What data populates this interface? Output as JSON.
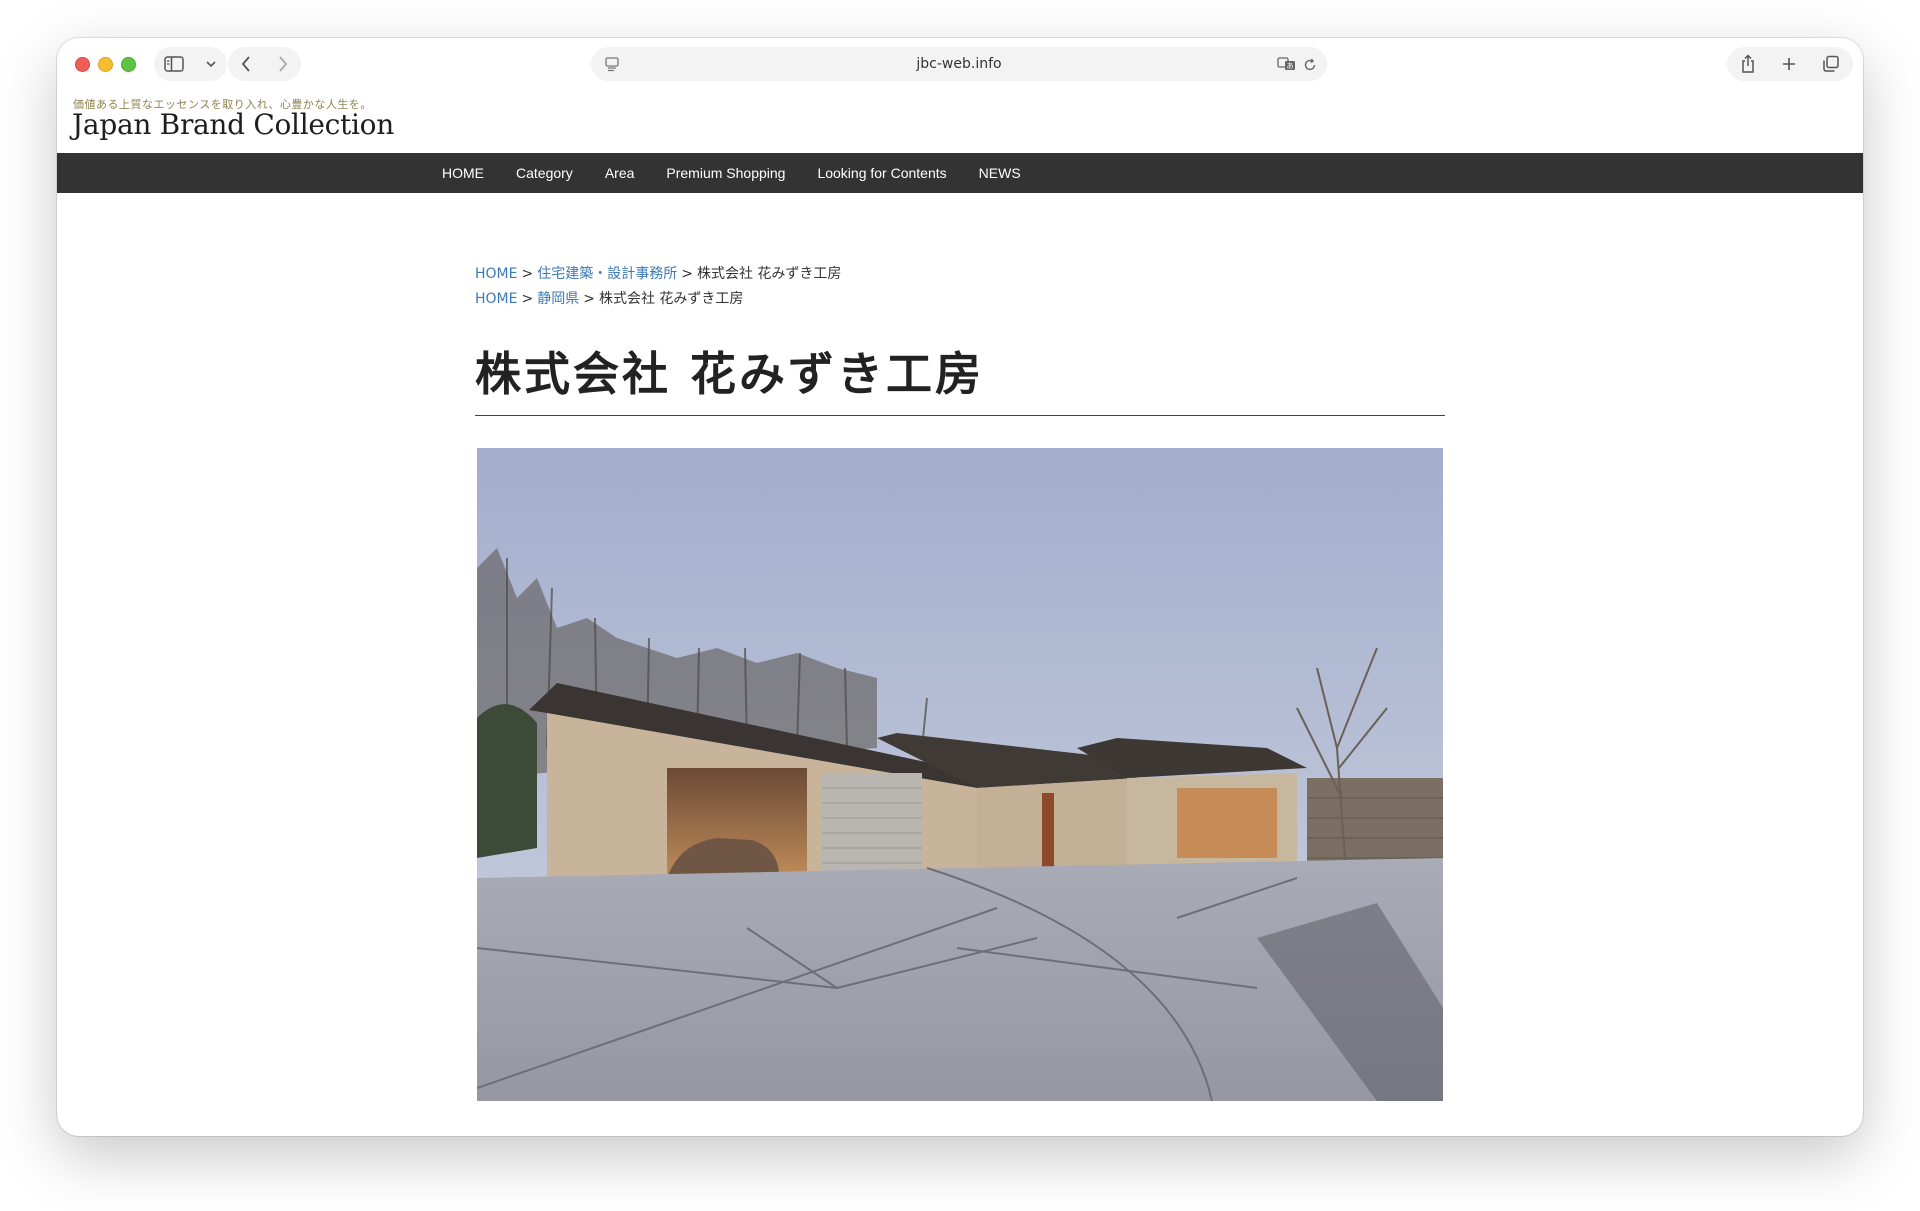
{
  "browser": {
    "url": "jbc-web.info"
  },
  "site": {
    "tagline": "価値ある上質なエッセンスを取り入れ、心豊かな人生を。",
    "logo": "Japan Brand Collection"
  },
  "nav": {
    "items": [
      "HOME",
      "Category",
      "Area",
      "Premium Shopping",
      "Looking for Contents",
      "NEWS"
    ]
  },
  "breadcrumbs": [
    {
      "home": "HOME",
      "link": "住宅建築・設計事務所",
      "current": "株式会社 花みずき工房"
    },
    {
      "home": "HOME",
      "link": "静岡県",
      "current": "株式会社 花みずき工房"
    }
  ],
  "page": {
    "title": "株式会社 花みずき工房"
  },
  "colors": {
    "navbar": "#333333",
    "link": "#3d7ab5",
    "tagline": "#8f8250"
  }
}
